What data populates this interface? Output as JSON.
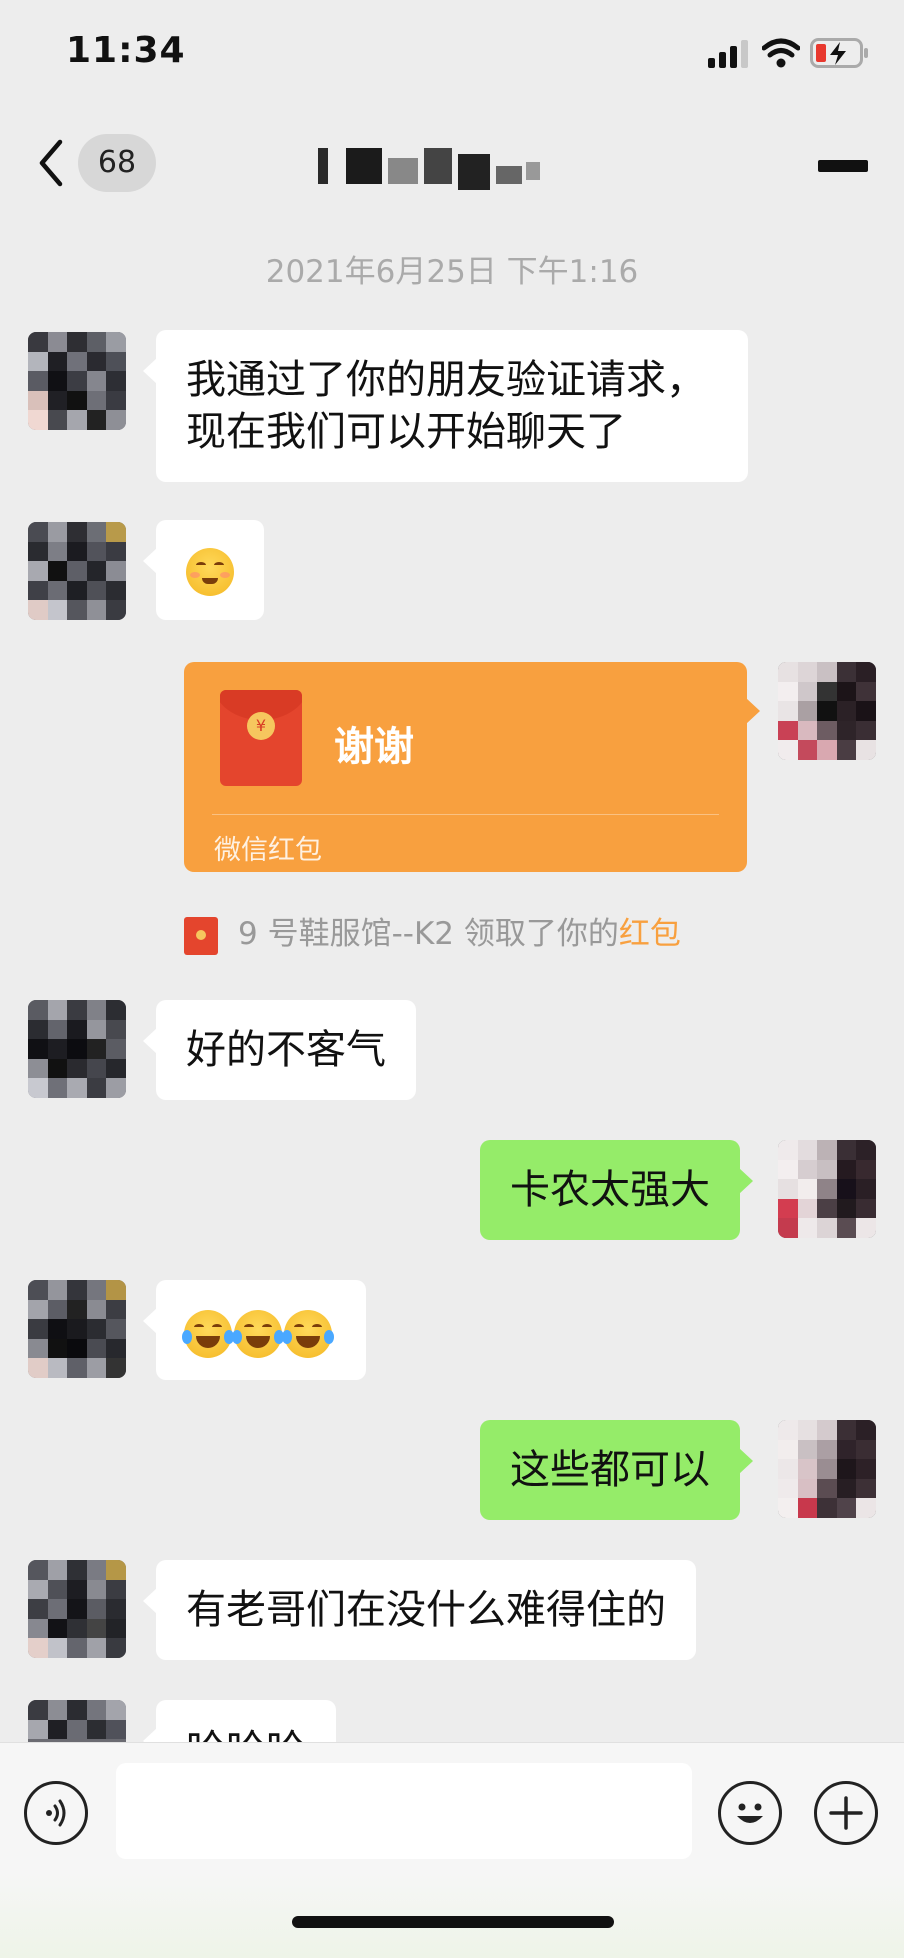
{
  "status_bar": {
    "time": "11:34"
  },
  "nav": {
    "unread_count": "68"
  },
  "time_divider": "2021年6月25日 下午1:16",
  "messages": {
    "m1": "我通过了你的朋友验证请求，",
    "m1b": "现在我们可以开始聊天了",
    "m4": "好的不客气",
    "m5": "卡农太强大",
    "m7": "这些都可以",
    "m8": "有老哥们在没什么难得住的",
    "m9": "哈哈哈"
  },
  "red_packet": {
    "title": "谢谢",
    "footer": "微信红包",
    "coin_symbol": "¥"
  },
  "system_note": {
    "text": "9 号鞋服馆--K2 领取了你的",
    "link": "红包"
  },
  "emoji": {
    "m2": "blush-face",
    "m6": [
      "tears-of-joy-face",
      "tears-of-joy-face",
      "tears-of-joy-face"
    ]
  },
  "colors": {
    "background": "#ededed",
    "received_bubble": "#ffffff",
    "sent_bubble": "#95ec69",
    "red_packet": "#f8a03f",
    "link": "#f8a03f"
  }
}
